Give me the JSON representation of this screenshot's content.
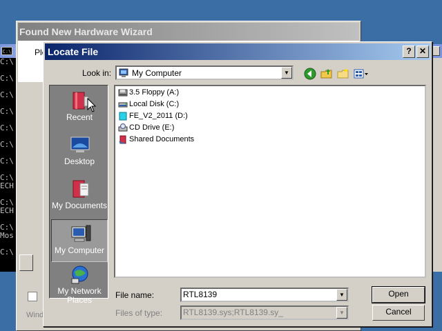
{
  "console": {
    "title_icon": "C:\\",
    "lines": [
      "C:\\",
      "",
      "C:\\",
      "",
      "C:\\",
      "",
      "C:\\",
      "",
      "C:\\",
      "",
      "C:\\",
      "",
      "C:\\",
      "",
      "C:\\",
      "ECH",
      "",
      "C:\\",
      "ECH",
      "",
      "C:\\",
      "Mos",
      "",
      "C:\\"
    ]
  },
  "wizard": {
    "title": "Found New Hardware Wizard",
    "prompt_partial": "Ple",
    "footer_partial": "Wind"
  },
  "dialog": {
    "title": "Locate File",
    "help_button": "?",
    "close_button": "✕",
    "look_in_label": "Look in:",
    "look_in_value": "My Computer",
    "places": [
      {
        "label": "Recent",
        "icon": "recent-icon"
      },
      {
        "label": "Desktop",
        "icon": "desktop-icon"
      },
      {
        "label": "My Documents",
        "icon": "my-documents-icon"
      },
      {
        "label": "My Computer",
        "icon": "my-computer-icon"
      },
      {
        "label": "My Network Places",
        "icon": "network-places-icon"
      }
    ],
    "files": [
      {
        "name": "3.5 Floppy (A:)",
        "icon": "floppy-drive-icon"
      },
      {
        "name": "Local Disk (C:)",
        "icon": "hard-disk-icon"
      },
      {
        "name": "FE_V2_2011 (D:)",
        "icon": "cd-media-icon"
      },
      {
        "name": "CD Drive (E:)",
        "icon": "cd-drive-icon"
      },
      {
        "name": "Shared Documents",
        "icon": "shared-folder-icon"
      }
    ],
    "file_name_label": "File name:",
    "file_name_value": "RTL8139",
    "files_of_type_label": "Files of type:",
    "files_of_type_value": "RTL8139.sys;RTL8139.sy_",
    "open_button": "Open",
    "cancel_button": "Cancel",
    "colors": {
      "title_start": "#0a246a",
      "title_end": "#a6caf0",
      "face": "#d4d0c8",
      "places_bg": "#808080"
    }
  }
}
